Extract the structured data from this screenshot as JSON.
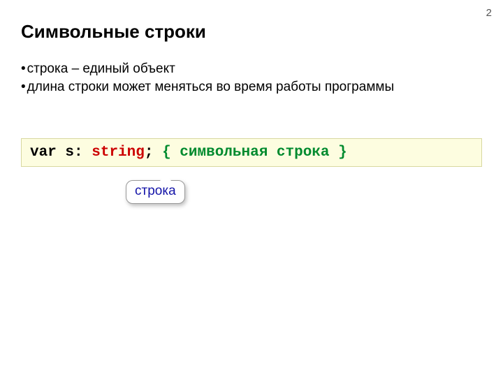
{
  "page_number": "2",
  "title": "Символьные строки",
  "bullets": [
    "строка – единый объект",
    "длина строки может меняться во время работы программы"
  ],
  "code": {
    "kw_var": "var",
    "ident": " s",
    "colon": ": ",
    "type": "string",
    "semi": ";",
    "spacer": "  ",
    "comment": "{ символьная строка }"
  },
  "callout": "строка"
}
